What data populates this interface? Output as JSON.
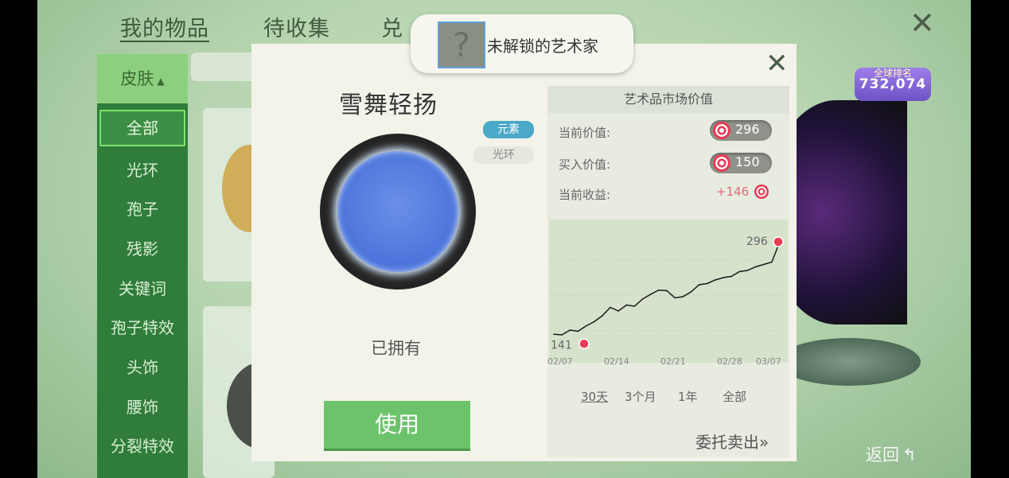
{
  "top_tabs": [
    "我的物品",
    "待收集",
    "兑"
  ],
  "sidebar": {
    "header": "皮肤",
    "items": [
      "全部",
      "光环",
      "孢子",
      "残影",
      "关键词",
      "孢子特效",
      "头饰",
      "腰饰",
      "分裂特效"
    ]
  },
  "artist_popup": {
    "icon": "?",
    "label": "未解锁的艺术家"
  },
  "item": {
    "name": "雪舞轻扬",
    "tags": [
      "元素",
      "光环"
    ],
    "status": "已拥有",
    "use_button": "使用"
  },
  "market": {
    "title": "艺术品市场价值",
    "current_label": "当前价值:",
    "current_value": "296",
    "buy_label": "买入价值:",
    "buy_value": "150",
    "profit_label": "当前收益:",
    "profit_value": "+146",
    "ranges": [
      "30天",
      "3个月",
      "1年",
      "全部"
    ],
    "selected_range": "30天",
    "sell_label": "委托卖出»"
  },
  "chart_data": {
    "type": "line",
    "x": [
      "02/07",
      "02/08",
      "02/09",
      "02/10",
      "02/11",
      "02/12",
      "02/13",
      "02/14",
      "02/15",
      "02/16",
      "02/17",
      "02/18",
      "02/19",
      "02/20",
      "02/21",
      "02/22",
      "02/23",
      "02/24",
      "02/25",
      "02/26",
      "02/27",
      "02/28",
      "03/01",
      "03/02",
      "03/03",
      "03/04",
      "03/05",
      "03/06",
      "03/07"
    ],
    "y": [
      141,
      140,
      148,
      146,
      155,
      162,
      172,
      186,
      180,
      190,
      188,
      200,
      208,
      215,
      214,
      202,
      204,
      212,
      224,
      226,
      232,
      236,
      238,
      246,
      248,
      254,
      258,
      262,
      296
    ],
    "xticks": [
      "02/07",
      "02/14",
      "02/21",
      "02/28",
      "03/07"
    ],
    "start_label": "141",
    "end_label": "296",
    "ylim": [
      120,
      320
    ]
  },
  "rank_badge": {
    "title": "全球排名",
    "score": "732,074"
  },
  "back_label": "返回",
  "colors": {
    "green_dark": "#2f7c3b",
    "green_btn": "#6cc36b",
    "line": "#1a1a1a",
    "candy": "#e83b56"
  }
}
